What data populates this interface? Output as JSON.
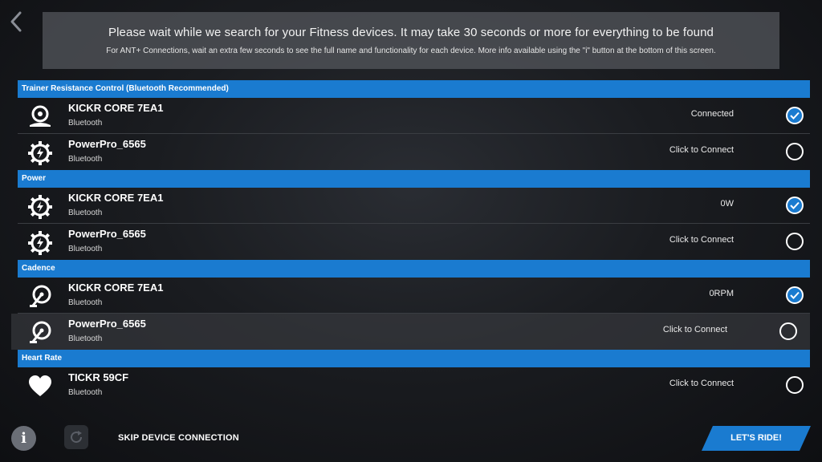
{
  "colors": {
    "accent": "#1a7bd0",
    "background": "#1a1c20",
    "banner": "#56595e"
  },
  "back_icon": "chevron-left-icon",
  "banner": {
    "title": "Please wait while we search for your Fitness devices. It may take 30 seconds or more for everything to be found",
    "subtitle": "For ANT+ Connections, wait an extra few seconds to see the full name and functionality for each device. More info available using the \"i\" button at the bottom of this screen."
  },
  "sections": [
    {
      "header": "Trainer Resistance Control (Bluetooth Recommended)",
      "devices": [
        {
          "name": "KICKR CORE 7EA1",
          "connection": "Bluetooth",
          "status": "Connected",
          "selected": true,
          "icon": "trainer-icon"
        },
        {
          "name": "PowerPro_6565",
          "connection": "Bluetooth",
          "status": "Click to Connect",
          "selected": false,
          "icon": "power-gear-icon"
        }
      ]
    },
    {
      "header": "Power",
      "devices": [
        {
          "name": "KICKR CORE 7EA1",
          "connection": "Bluetooth",
          "status": "0W",
          "selected": true,
          "icon": "power-gear-icon"
        },
        {
          "name": "PowerPro_6565",
          "connection": "Bluetooth",
          "status": "Click to Connect",
          "selected": false,
          "icon": "power-gear-icon"
        }
      ]
    },
    {
      "header": "Cadence",
      "devices": [
        {
          "name": "KICKR CORE 7EA1",
          "connection": "Bluetooth",
          "status": "0RPM",
          "selected": true,
          "icon": "cadence-crank-icon"
        },
        {
          "name": "PowerPro_6565",
          "connection": "Bluetooth",
          "status": "Click to Connect",
          "selected": false,
          "icon": "cadence-crank-icon"
        }
      ]
    },
    {
      "header": "Heart Rate",
      "devices": [
        {
          "name": "TICKR 59CF",
          "connection": "Bluetooth",
          "status": "Click to Connect",
          "selected": false,
          "icon": "heart-icon"
        }
      ]
    }
  ],
  "footer": {
    "info_label": "i",
    "skip_label": "SKIP DEVICE CONNECTION",
    "ride_label": "LET'S RIDE!"
  }
}
